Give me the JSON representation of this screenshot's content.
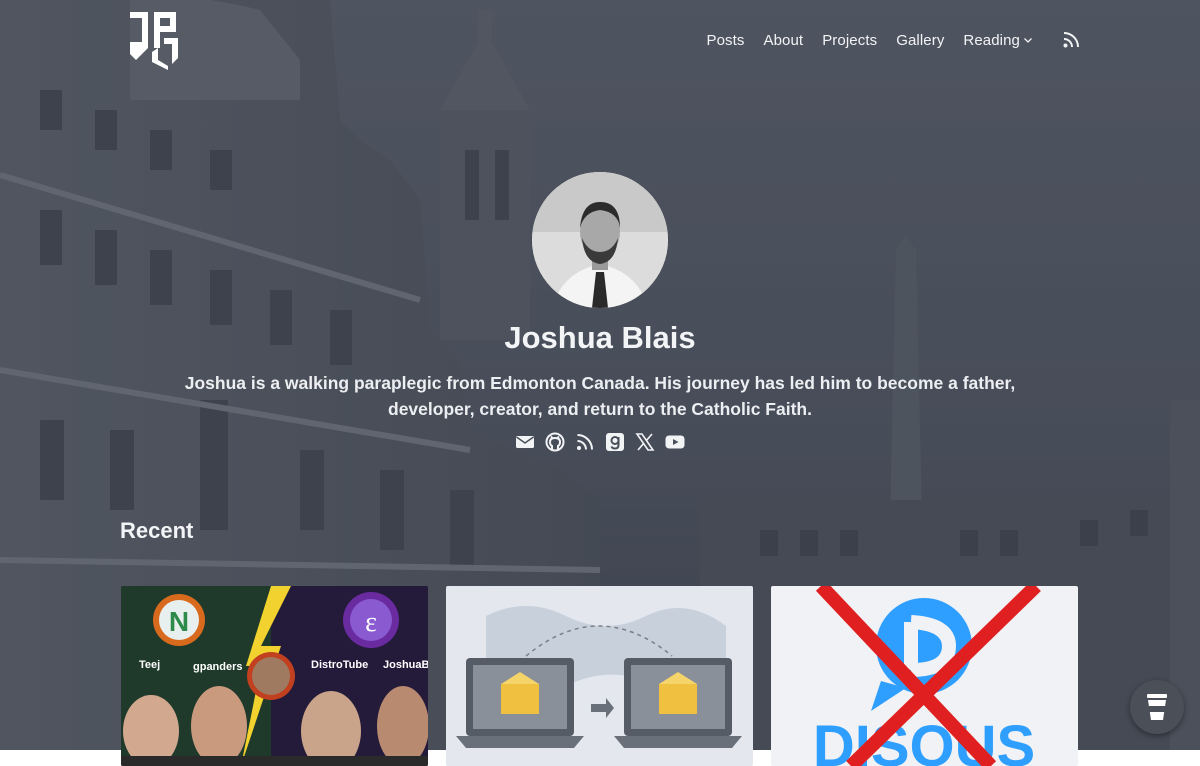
{
  "nav": {
    "items": [
      {
        "label": "Posts"
      },
      {
        "label": "About"
      },
      {
        "label": "Projects"
      },
      {
        "label": "Gallery"
      },
      {
        "label": "Reading"
      }
    ],
    "rss_icon": "rss-icon"
  },
  "profile": {
    "name": "Joshua Blais",
    "bio": "Joshua is a walking paraplegic from Edmonton Canada. His journey has led him to become a father, developer, creator, and return to the Catholic Faith.",
    "social_icons": [
      "email-icon",
      "github-icon",
      "rss-icon",
      "goodreads-icon",
      "x-icon",
      "youtube-icon"
    ]
  },
  "recent": {
    "heading": "Recent",
    "cards": [
      {
        "labels": [
          "Teej",
          "gpanders",
          "DistroTube",
          "JoshuaBl"
        ]
      },
      {
        "icon": "email-transfer-icon"
      },
      {
        "icon": "disqus-crossed-icon",
        "text": "DISQUS"
      }
    ]
  },
  "colors": {
    "overlay": "#3c4250",
    "accent": "#e02020",
    "disqus_blue": "#2e9fff"
  }
}
